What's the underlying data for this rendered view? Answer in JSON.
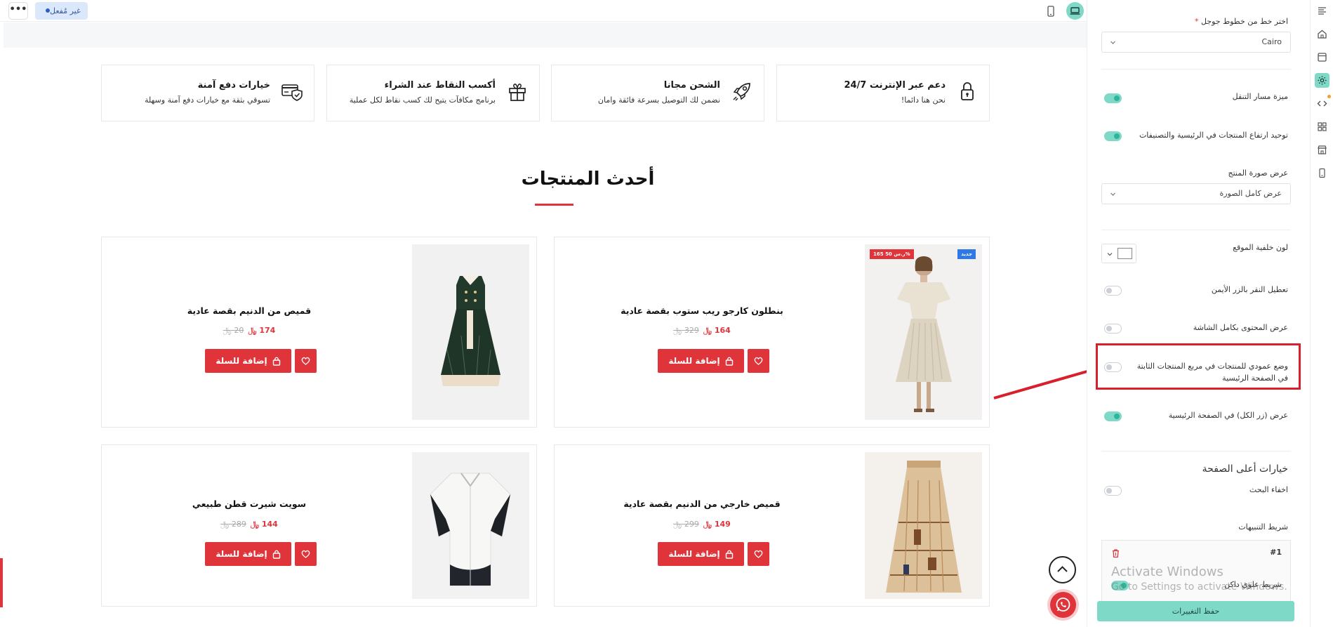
{
  "topbar": {
    "more_label": "•••",
    "status_label": "غير مُفعل"
  },
  "features": [
    {
      "title": "دعم عبر الإنترنت 24/7",
      "subtitle": "نحن هنا دائما!",
      "icon": "lock-icon"
    },
    {
      "title": "الشحن مجانا",
      "subtitle": "نضمن لك التوصيل بسرعة فائقة وامان",
      "icon": "rocket-icon"
    },
    {
      "title": "أكسب النقاط عند الشراء",
      "subtitle": "برنامج مكافآت يتيح لك كسب نقاط لكل عملية",
      "icon": "gift-icon"
    },
    {
      "title": "خيارات دفع آمنة",
      "subtitle": "تسوقي بثقة مع خيارات دفع آمنة وسهلة",
      "icon": "secure-card-icon"
    }
  ],
  "section_title": "أحدث المنتجات",
  "products": [
    {
      "name": "بنطلون كارجو ريب ستوب بقصة عادية",
      "price": "164",
      "old_price": "329",
      "badge_blue": "جديد",
      "badge_red": "165 ر.س 50%",
      "image": "cream-dress"
    },
    {
      "name": "قميص من الدنيم بقصة عادية",
      "price": "174",
      "old_price": "20",
      "image": "green-dress"
    },
    {
      "name": "قميص خارجي من الدنيم بقصة عادية",
      "price": "149",
      "old_price": "299",
      "image": "printed-skirt"
    },
    {
      "name": "سويت شيرت قطن طبيعي",
      "price": "144",
      "old_price": "289",
      "image": "white-shirt"
    }
  ],
  "cart_label": "إضافة للسلة",
  "currency_symbol": "﷼",
  "panel": {
    "font_label": "اختر خط من خطوط جوجل",
    "font_required": "*",
    "font_value": "Cairo",
    "breadcrumb_feature": "ميزة مسار التنقل",
    "unify_heights": "توحيد ارتفاع المنتجات في الرئيسية والتصنيفات",
    "image_display_label": "عرض صورة المنتج",
    "image_display_value": "عرض كامل الصورة",
    "bg_color_label": "لون خلفية الموقع",
    "bg_color_value": "#ffffff",
    "disable_right_click": "تعطيل النقر بالزر الأيمن",
    "full_width": "عرض المحتوى بكامل الشاشة",
    "vertical_mode": "وضع عمودي للمنتجات في مربع المنتجات الثابتة في الصفحة الرئيسية",
    "show_all_button": "عرض (زر الكل) في الصفحة الرئيسية",
    "top_options_title": "خيارات أعلى الصفحة",
    "hide_search": "اخفاء البحث",
    "notification_bar": "شريط التنبيهات",
    "notif_index": "#1",
    "top_bar_dark": "شريط علوي داكن",
    "save_label": "حفظ التغييرات",
    "toggles": {
      "breadcrumb": true,
      "unify": true,
      "right_click": false,
      "full_width": false,
      "vertical": false,
      "show_all": true,
      "hide_search": false,
      "dark_bar": true
    }
  },
  "watermark": {
    "line1": "Activate Windows",
    "line2": "Go to Settings to activate Windows."
  },
  "colors": {
    "accent_red": "#e0343b",
    "accent_teal": "#7fd9c7",
    "toggle_on": "#2fb59a",
    "badge_blue": "#2f78e8"
  }
}
